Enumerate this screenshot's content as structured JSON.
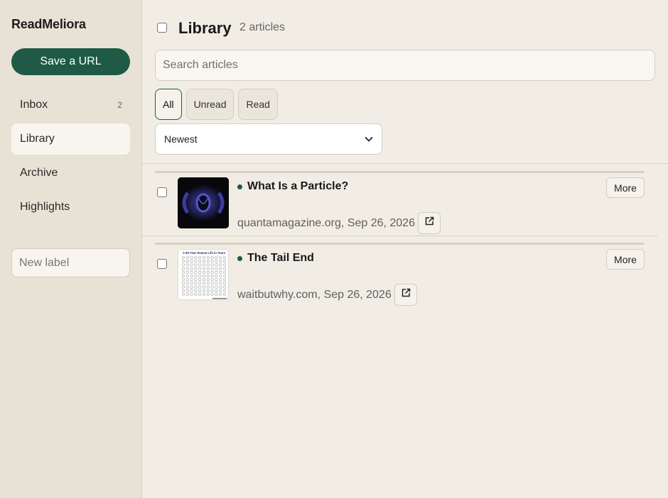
{
  "app": {
    "name": "ReadMeliora"
  },
  "sidebar": {
    "save_label": "Save a URL",
    "items": [
      {
        "label": "Inbox",
        "count": "2"
      },
      {
        "label": "Library",
        "count": ""
      },
      {
        "label": "Archive",
        "count": ""
      },
      {
        "label": "Highlights",
        "count": ""
      }
    ],
    "new_label_placeholder": "New label"
  },
  "header": {
    "title": "Library",
    "count_text": "2 articles",
    "search_placeholder": "Search articles",
    "filters": [
      "All",
      "Unread",
      "Read"
    ],
    "active_filter": "All",
    "sort_value": "Newest"
  },
  "articles": [
    {
      "title": "What Is a Particle?",
      "meta": "quantamagazine.org, Sep 26, 2026",
      "more_label": "More",
      "unread": true
    },
    {
      "title": "The Tail End",
      "meta": "waitbutwhy.com, Sep 26, 2026",
      "more_label": "More",
      "unread": true,
      "thumb_heading": "A 90-Year Human Life in Years"
    }
  ],
  "colors": {
    "accent": "#1e5a45",
    "sidebar_bg": "#e7e1d6",
    "main_bg": "#f1ede5"
  }
}
